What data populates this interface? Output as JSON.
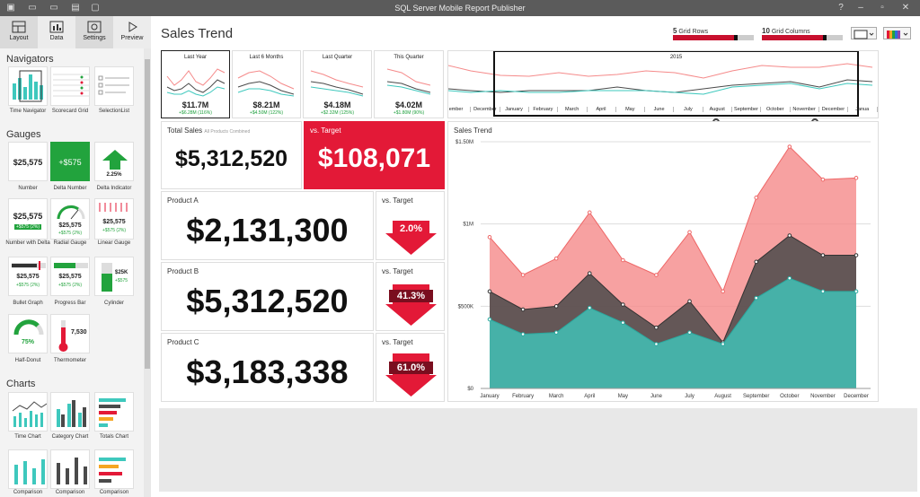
{
  "window": {
    "title": "SQL Server Mobile Report Publisher"
  },
  "ribbon": {
    "tabs": [
      {
        "label": "Layout"
      },
      {
        "label": "Data"
      },
      {
        "label": "Settings"
      },
      {
        "label": "Preview"
      }
    ]
  },
  "toolbox": {
    "navigators": {
      "header": "Navigators",
      "items": [
        "Time Navigator",
        "Scorecard Grid",
        "SelectionList"
      ]
    },
    "gauges": {
      "header": "Gauges",
      "items": [
        "Number",
        "Delta Number",
        "Delta Indicator",
        "Number with Delta",
        "Radial Gauge",
        "Linear Gauge",
        "Bullet Graph",
        "Progress Bar",
        "Cylinder",
        "Half-Donut",
        "Thermometer"
      ],
      "number_value": "$25,575",
      "delta_value": "+$575",
      "delta_pct": "2.25%",
      "with_delta": "+$575 (2%)",
      "cyl_value": "$25K",
      "cyl_delta": "+$575",
      "half_pct": "75%",
      "therm_value": "7,530"
    },
    "charts": {
      "header": "Charts",
      "items": [
        "Time Chart",
        "Category Chart",
        "Totals Chart",
        "Comparison",
        "Comparison",
        "Comparison"
      ]
    }
  },
  "report": {
    "title": "Sales Trend",
    "grid_rows": {
      "value": "5",
      "label": "Grid Rows"
    },
    "grid_columns": {
      "value": "10",
      "label": "Grid Columns"
    },
    "kpis": [
      {
        "title": "Last Year",
        "value": "$11.7M",
        "delta": "+$6.28M (116%)"
      },
      {
        "title": "Last 6 Months",
        "value": "$8.21M",
        "delta": "+$4.50M (122%)"
      },
      {
        "title": "Last Quarter",
        "value": "$4.18M",
        "delta": "+$2.32M (125%)"
      },
      {
        "title": "This Quarter",
        "value": "$4.02M",
        "delta": "+$1.80M (90%)"
      }
    ],
    "total": {
      "label": "Total Sales",
      "sub": "All Products Combined",
      "value": "$5,312,520"
    },
    "vs_target": {
      "label": "vs. Target",
      "value": "$108,071"
    },
    "products": [
      {
        "label": "Product A",
        "value": "$2,131,300",
        "target_label": "vs. Target",
        "pct": "2.0%"
      },
      {
        "label": "Product B",
        "value": "$5,312,520",
        "target_label": "vs. Target",
        "pct": "41.3%"
      },
      {
        "label": "Product C",
        "value": "$3,183,338",
        "target_label": "vs. Target",
        "pct": "61.0%"
      }
    ],
    "navigator": {
      "year": "2015",
      "months": [
        "ember",
        "December",
        "January",
        "February",
        "March",
        "April",
        "May",
        "June",
        "July",
        "August",
        "September",
        "October",
        "November",
        "December",
        "Janua",
        "Febru"
      ]
    }
  },
  "colors": {
    "red": "#f58a8a",
    "dark": "#4a4a4a",
    "teal": "#3ec8bd",
    "accent": "#e31937",
    "green": "#22a33d"
  },
  "chart_data": {
    "type": "area",
    "title": "Sales Trend",
    "categories": [
      "January",
      "February",
      "March",
      "April",
      "May",
      "June",
      "July",
      "August",
      "September",
      "October",
      "November",
      "December"
    ],
    "yticks": [
      "$0",
      "$500K",
      "$1M",
      "$1.50M"
    ],
    "ylim": [
      0,
      1500000
    ],
    "series": [
      {
        "values": [
          920000,
          690000,
          790000,
          1070000,
          780000,
          690000,
          950000,
          590000,
          1160000,
          1470000,
          1270000,
          1280000
        ]
      },
      {
        "values": [
          590000,
          480000,
          500000,
          700000,
          510000,
          370000,
          530000,
          280000,
          770000,
          930000,
          810000,
          810000
        ]
      },
      {
        "values": [
          420000,
          330000,
          340000,
          490000,
          400000,
          270000,
          340000,
          270000,
          550000,
          670000,
          590000,
          590000
        ]
      }
    ]
  }
}
